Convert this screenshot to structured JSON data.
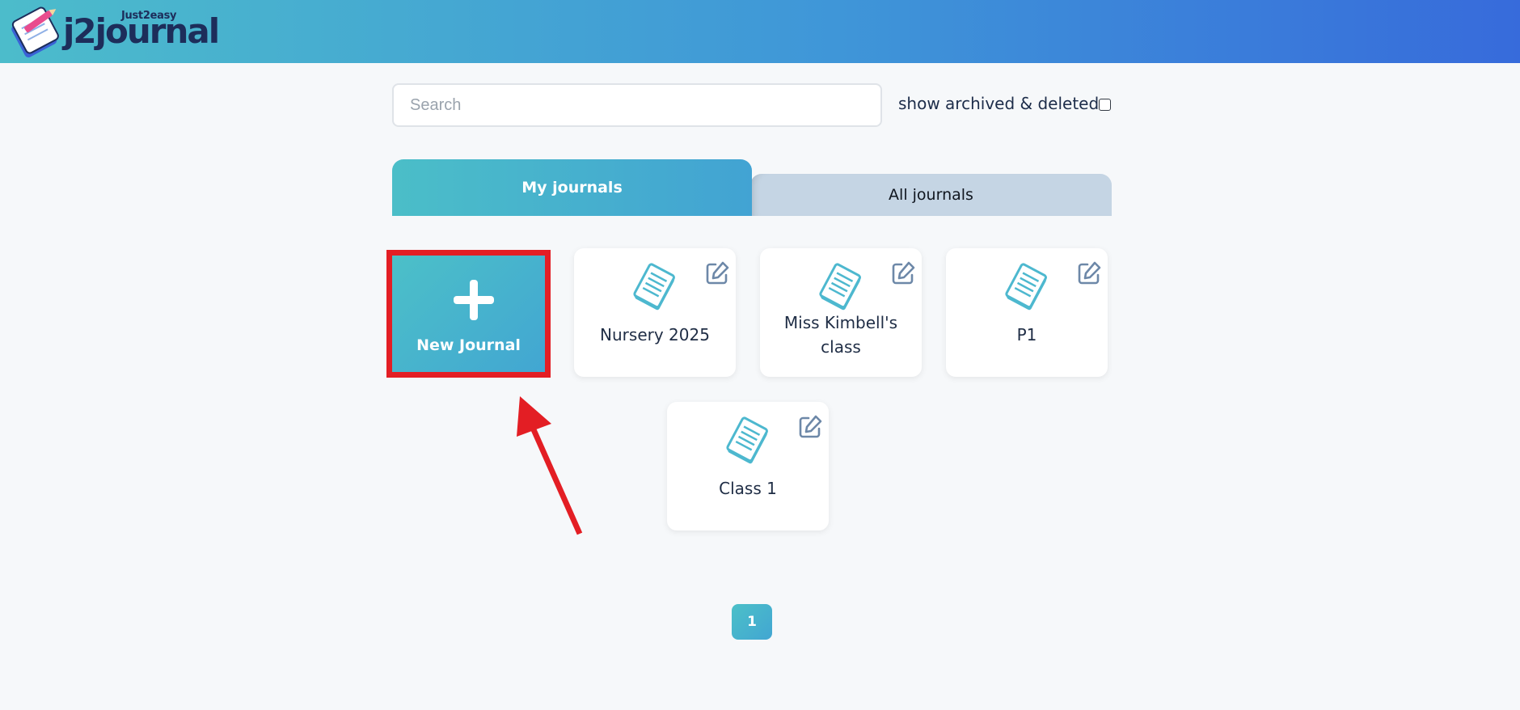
{
  "header": {
    "logo_tagline": "Just2easy",
    "logo_wordmark": "j2journal"
  },
  "search": {
    "placeholder": "Search",
    "value": ""
  },
  "filters": {
    "show_archived_label": "show archived & deleted",
    "show_archived_checked": false
  },
  "tabs": [
    {
      "label": "My journals",
      "active": true
    },
    {
      "label": "All journals",
      "active": false
    }
  ],
  "new_journal": {
    "label": "New Journal"
  },
  "journals": [
    {
      "title": "Nursery 2025"
    },
    {
      "title": "Miss Kimbell's class"
    },
    {
      "title": "P1"
    },
    {
      "title": "Class 1"
    }
  ],
  "pagination": {
    "current_page": "1"
  },
  "colors": {
    "accent_teal": "#4cc0c8",
    "accent_blue": "#42a6d2",
    "highlight_red": "#e31e24",
    "header_end_blue": "#376bdb"
  },
  "annotation": {
    "arrow_color": "#e31e24",
    "highlight_target": "new-journal-button"
  }
}
